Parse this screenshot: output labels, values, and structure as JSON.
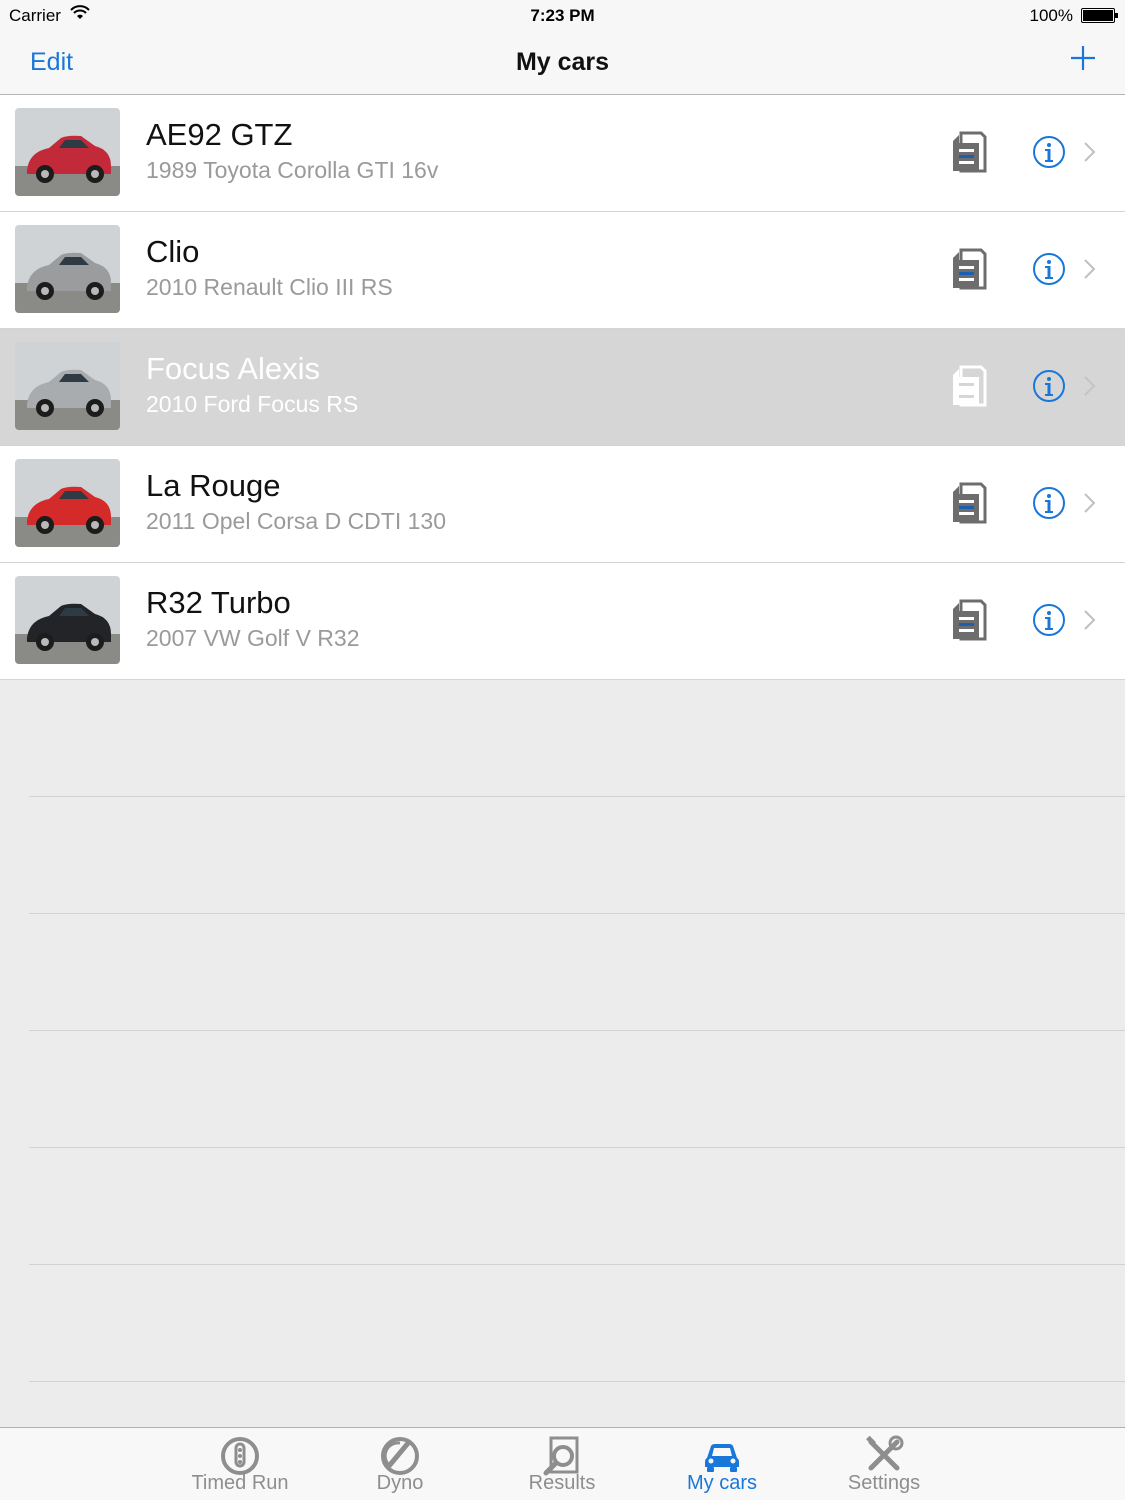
{
  "status_bar": {
    "carrier": "Carrier",
    "time": "7:23 PM",
    "battery": "100%"
  },
  "nav_bar": {
    "left_button": "Edit",
    "title": "My cars",
    "right_icon": "plus-icon"
  },
  "cars": [
    {
      "name": "AE92 GTZ",
      "description": "1989 Toyota Corolla GTI 16v",
      "photo_color": "#c22a3a",
      "selected": false
    },
    {
      "name": "Clio",
      "description": "2010 Renault Clio III RS",
      "photo_color": "#9a9c9e",
      "selected": false
    },
    {
      "name": "Focus Alexis",
      "description": "2010 Ford  Focus RS",
      "photo_color": "#a9acaf",
      "selected": true
    },
    {
      "name": "La Rouge",
      "description": "2011 Opel Corsa D CDTI 130",
      "photo_color": "#d42a2a",
      "selected": false
    },
    {
      "name": "R32 Turbo",
      "description": "2007 VW Golf V R32",
      "photo_color": "#222428",
      "selected": false
    }
  ],
  "tabs": [
    {
      "label": "Timed Run",
      "icon": "stopwatch-icon",
      "active": false
    },
    {
      "label": "Dyno",
      "icon": "gauge-icon",
      "active": false
    },
    {
      "label": "Results",
      "icon": "magnifier-icon",
      "active": false
    },
    {
      "label": "My cars",
      "icon": "car-icon",
      "active": true
    },
    {
      "label": "Settings",
      "icon": "tools-icon",
      "active": false
    }
  ],
  "colors": {
    "accent": "#1877d9",
    "selected_row": "#d6d6d6",
    "subtitle_gray": "#9a9a9a"
  }
}
